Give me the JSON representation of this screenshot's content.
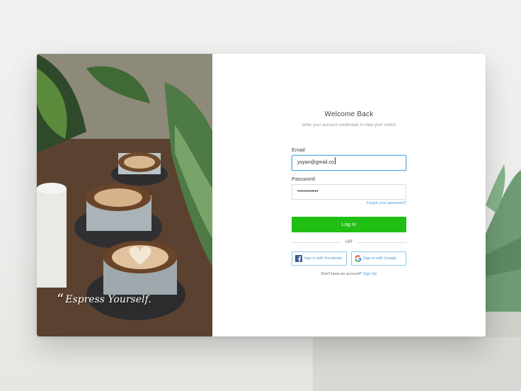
{
  "photo_quote": "Espress Yourself.",
  "header": {
    "title": "Welcome Back",
    "subtitle": "enter your account credentials to view your orders"
  },
  "form": {
    "email_label": "Email",
    "email_value": "yuyan@gmail.co",
    "password_label": "Password",
    "password_value": "••••••••••••",
    "forgot_label": "Forgot your password?",
    "login_label": "Log In",
    "or_label": "OR",
    "facebook_label": "Sign in with Facebook",
    "google_label": "Sign in with Google",
    "no_account_text": "Don't have an account?",
    "signup_label": "Sign Up"
  },
  "colors": {
    "accent_green": "#1fc013",
    "link_blue": "#4a9ad6",
    "focus_blue": "#5fb2e8",
    "facebook_blue": "#3b5998"
  }
}
